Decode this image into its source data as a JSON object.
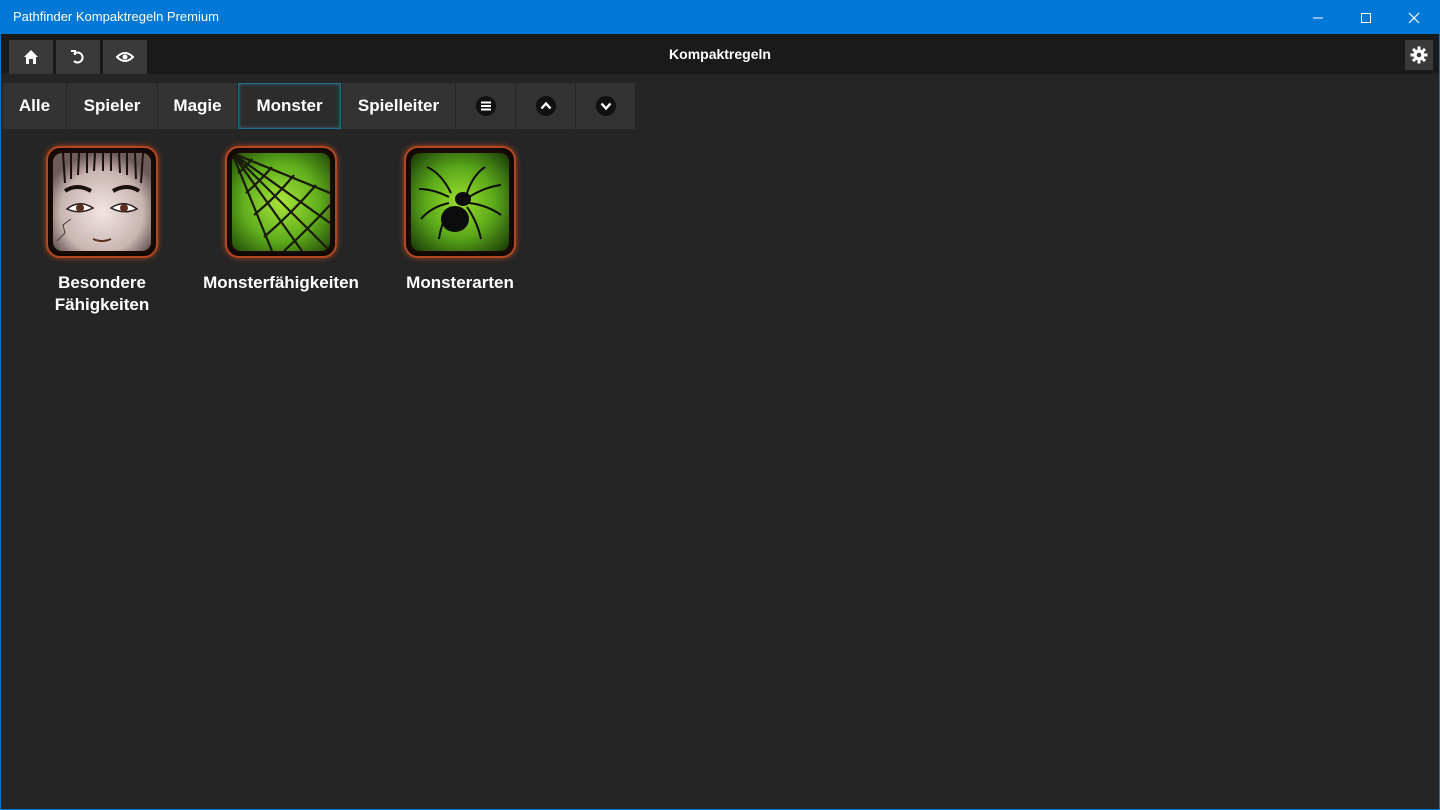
{
  "window": {
    "title": "Pathfinder Kompaktregeln Premium"
  },
  "toolbar": {
    "title": "Kompaktregeln",
    "home_icon": "home-icon",
    "back_icon": "undo-icon",
    "view_icon": "eye-icon",
    "settings_icon": "gear-icon"
  },
  "tabs": [
    {
      "label": "Alle"
    },
    {
      "label": "Spieler"
    },
    {
      "label": "Magie"
    },
    {
      "label": "Monster",
      "active": true
    },
    {
      "label": "Spielleiter"
    }
  ],
  "tab_icons": [
    "menu-icon",
    "chevron-up-icon",
    "chevron-down-icon"
  ],
  "tiles": [
    {
      "label_line1": "Besondere",
      "label_line2": "Fähigkeiten",
      "icon": "face-icon"
    },
    {
      "label_line1": "Monsterfähigkeiten",
      "icon": "spiderweb-icon"
    },
    {
      "label_line1": "Monsterarten",
      "icon": "spider-icon"
    }
  ],
  "colors": {
    "titlebar": "#0078d7",
    "background": "#252525",
    "tile_border": "#b3471f",
    "accent_green": "#6fbf1f"
  }
}
